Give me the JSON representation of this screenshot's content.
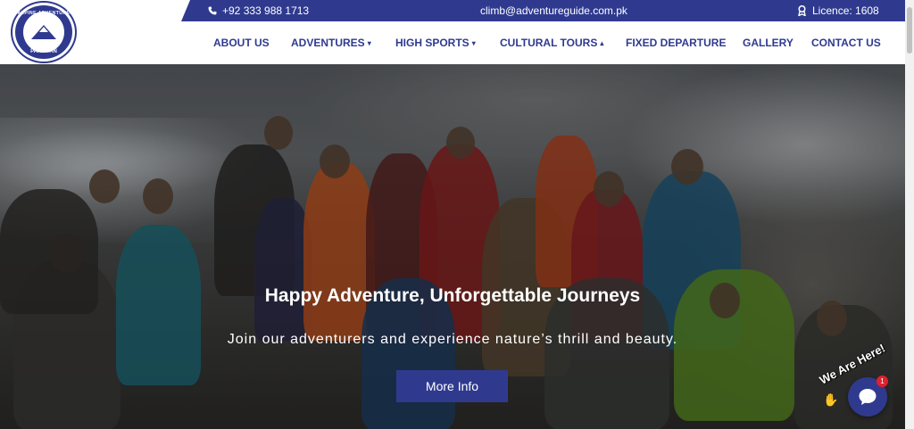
{
  "brand": {
    "logo_top_text": "ALPINE ADVENTURE GUIDES",
    "logo_bottom_text": "PAKISTAN"
  },
  "topbar": {
    "phone": "+92 333 988 1713",
    "email": "climb@adventureguide.com.pk",
    "licence": "Licence: 1608"
  },
  "nav": {
    "items": [
      {
        "label": "ABOUT US",
        "chevron": ""
      },
      {
        "label": "ADVENTURES",
        "chevron": "▾"
      },
      {
        "label": "HIGH SPORTS",
        "chevron": "▾"
      },
      {
        "label": "CULTURAL TOURS",
        "chevron": "▴"
      },
      {
        "label": "FIXED DEPARTURE",
        "chevron": ""
      },
      {
        "label": "GALLERY",
        "chevron": ""
      },
      {
        "label": "CONTACT US",
        "chevron": ""
      }
    ]
  },
  "hero": {
    "title": "Happy Adventure, Unforgettable Journeys",
    "subtitle": "Join our adventurers and experience nature’s thrill and beauty.",
    "button_label": "More Info"
  },
  "chat": {
    "tagline": "We Are Here!",
    "badge_count": "1"
  },
  "colors": {
    "brand": "#2f3a8f",
    "badge": "#e0202e"
  }
}
